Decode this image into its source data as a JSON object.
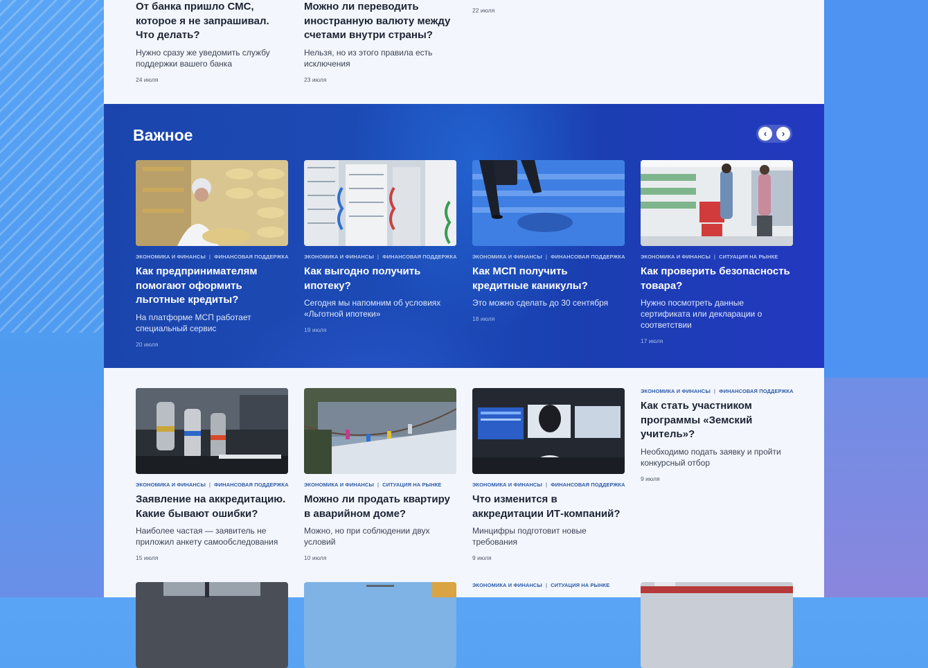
{
  "top_row": [
    {
      "title": "От банка пришло СМС, которое я не запрашивал. Что делать?",
      "desc": "Нужно сразу же уведомить службу поддержки вашего банка",
      "date": "24 июля"
    },
    {
      "title": "Можно ли переводить иностранную валюту между счетами внутри страны?",
      "desc": "Нельзя, но из этого правила есть исключения",
      "date": "23 июля"
    },
    {
      "date": "22 июля"
    }
  ],
  "important": {
    "title": "Важное",
    "prev_label": "‹",
    "next_label": "›",
    "cards": [
      {
        "tag1": "Экономика и финансы",
        "tag2": "Финансовая поддержка",
        "title": "Как предпринимателям помогают оформить льготные кредиты?",
        "desc": "На платформе МСП работает специальный сервис",
        "date": "20 июля"
      },
      {
        "tag1": "Экономика и финансы",
        "tag2": "Финансовая поддержка",
        "title": "Как выгодно получить ипотеку?",
        "desc": "Сегодня мы напомним об условиях «Льготной ипотеки»",
        "date": "19 июля"
      },
      {
        "tag1": "Экономика и финансы",
        "tag2": "Финансовая поддержка",
        "title": "Как МСП получить кредитные каникулы?",
        "desc": "Это можно сделать до 30 сентября",
        "date": "18 июля"
      },
      {
        "tag1": "Экономика и финансы",
        "tag2": "Ситуация на рынке",
        "title": "Как проверить безопасность товара?",
        "desc": "Нужно посмотреть данные сертификата или декларации о соответствии",
        "date": "17 июля"
      }
    ]
  },
  "grid": [
    {
      "tag1": "Экономика и финансы",
      "tag2": "Финансовая поддержка",
      "title": "Заявление на аккредитацию. Какие бывают ошибки?",
      "desc": "Наиболее частая — заявитель не приложил анкету самообследования",
      "date": "15 июля"
    },
    {
      "tag1": "Экономика и финансы",
      "tag2": "Ситуация на рынке",
      "title": "Можно ли продать квартиру в аварийном доме?",
      "desc": "Можно, но при соблюдении двух условий",
      "date": "10 июля"
    },
    {
      "tag1": "Экономика и финансы",
      "tag2": "Финансовая поддержка",
      "title": "Что изменится в аккредитации ИТ-компаний?",
      "desc": "Минцифры подготовит новые требования",
      "date": "9 июля"
    },
    {
      "tag1": "Экономика и финансы",
      "tag2": "Финансовая поддержка",
      "title": "Как стать участником программы «Земский учитель»?",
      "desc": "Необходимо подать заявку и пройти конкурсный отбор",
      "date": "9 июля"
    }
  ],
  "bottom_row": [
    {
      "tag1": "Экономика и финансы",
      "tag2": "Ситуация на рынке"
    }
  ]
}
